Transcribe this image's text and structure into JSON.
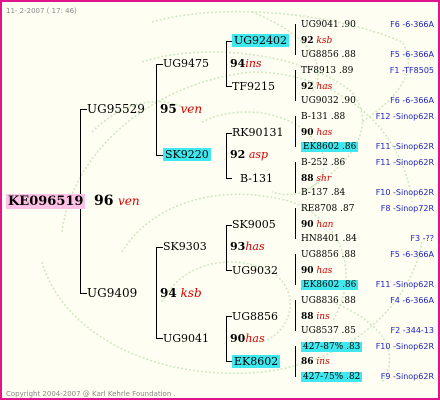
{
  "header": "11- 2-2007 ( 17: 46)",
  "footer": "Copyright 2004-2007 @ Karl Kehrle Foundation .",
  "root": {
    "id": "KE096519",
    "num": "96",
    "org": "ven"
  },
  "gen1": [
    {
      "id": "UG95529",
      "num": "95",
      "org": "ven"
    },
    {
      "id": "UG9409",
      "num": "94",
      "org": "ksb"
    }
  ],
  "gen2": [
    {
      "id": "UG9475",
      "num": "94",
      "org": "ins"
    },
    {
      "id": "SK9220",
      "num": "92",
      "org": "asp"
    },
    {
      "id": "SK9303",
      "num": "93",
      "org": "has"
    },
    {
      "id": "UG9041",
      "num": "90",
      "org": "has"
    }
  ],
  "gen3": [
    {
      "id": "UG92402",
      "num": "92",
      "org": "ksb"
    },
    {
      "id": "TF9215",
      "num": "92",
      "org": "has"
    },
    {
      "id": "RK90131",
      "num": "90",
      "org": "has"
    },
    {
      "id": "B-131",
      "num": "88",
      "org": "shr"
    },
    {
      "id": "SK9005",
      "num": "90",
      "org": "han"
    },
    {
      "id": "UG9032",
      "num": "90",
      "org": "has"
    },
    {
      "id": "UG8856",
      "num": "88",
      "org": "ins"
    },
    {
      "id": "EK8602",
      "num": "86",
      "org": "ins"
    }
  ],
  "gen4": [
    {
      "id": "UG9041 .90",
      "info": "F6 -6-366A"
    },
    {
      "id": "UG8856 .88",
      "info": "F5 -6-366A"
    },
    {
      "id": "TF8913 .89",
      "info": "F1 -TF8505"
    },
    {
      "id": "UG9032 .90",
      "info": "F6 -6-366A"
    },
    {
      "id": "B-131 .88",
      "info": "F12 -Sinop62R"
    },
    {
      "id": "EK8602 .86",
      "info": "F11 -Sinop62R"
    },
    {
      "id": "B-252 .86",
      "info": "F11 -Sinop62R"
    },
    {
      "id": "B-137 .84",
      "info": "F10 -Sinop62R"
    },
    {
      "id": "RE8708 .87",
      "info": "F8 -Sinop72R"
    },
    {
      "id": "HN8401 .84",
      "info": "F3 -??"
    },
    {
      "id": "UG8856 .88",
      "info": "F5 -6-366A"
    },
    {
      "id": "EK8602 .86",
      "info": "F11 -Sinop62R"
    },
    {
      "id": "UG8836 .88",
      "info": "F4 -6-366A"
    },
    {
      "id": "UG8537 .85",
      "info": "F2 -344-13"
    },
    {
      "id": "427-87% .83",
      "info": "F10 -Sinop62R"
    },
    {
      "id": "427-75% .82",
      "info": "F9 -Sinop62R"
    }
  ]
}
